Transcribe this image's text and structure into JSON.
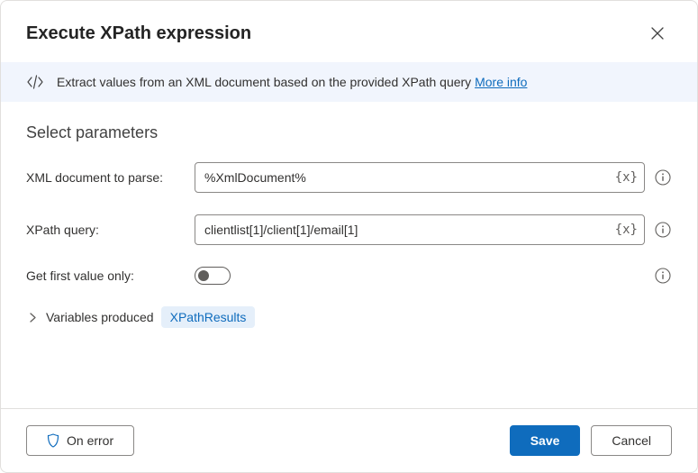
{
  "dialog": {
    "title": "Execute XPath expression",
    "description": "Extract values from an XML document based on the provided XPath query",
    "more_info": "More info"
  },
  "section": {
    "title": "Select parameters"
  },
  "params": {
    "xml_doc_label": "XML document to parse:",
    "xml_doc_value": "%XmlDocument%",
    "xpath_label": "XPath query:",
    "xpath_value": "clientlist[1]/client[1]/email[1]",
    "first_only_label": "Get first value only:",
    "var_token": "{x}"
  },
  "variables": {
    "label": "Variables produced",
    "chip": "XPathResults"
  },
  "footer": {
    "on_error": "On error",
    "save": "Save",
    "cancel": "Cancel"
  }
}
